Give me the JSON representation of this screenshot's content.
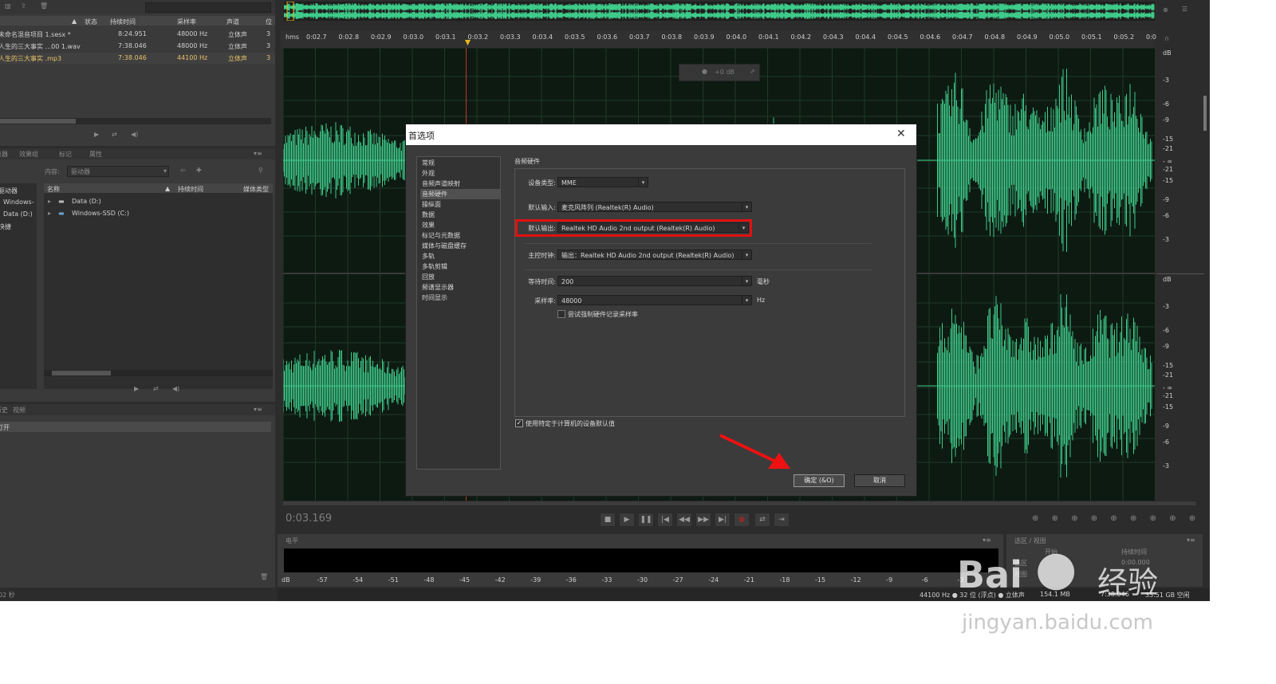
{
  "files_panel": {
    "headers": {
      "status": "状态",
      "duration": "持续时间",
      "sample_rate": "采样率",
      "channels": "声道",
      "extra": "位"
    },
    "rows": [
      {
        "name": "未命名混音项目 1.sesx *",
        "duration": "8:24.951",
        "sample_rate": "48000 Hz",
        "channels": "立体声",
        "extra": "3"
      },
      {
        "name": "人生的三大事实 ...00 1.wav",
        "duration": "7:38.046",
        "sample_rate": "48000 Hz",
        "channels": "立体声",
        "extra": "3"
      },
      {
        "name": "人生的三大事实 .mp3",
        "duration": "7:38.046",
        "sample_rate": "44100 Hz",
        "channels": "立体声",
        "extra": "3"
      }
    ]
  },
  "media_browser": {
    "tabs": [
      "媒体浏览器",
      "效果组",
      "标记",
      "属性"
    ],
    "content_label": "内容:",
    "content_value": "驱动器",
    "left_items": [
      "驱动器",
      "Windows-",
      "Data (D:)",
      "快捷"
    ],
    "headers": {
      "name": "名称",
      "duration": "持续时间",
      "media_type": "媒体类型"
    },
    "items": [
      "Data (D:)",
      "Windows-SSD (C:)"
    ]
  },
  "history_panel": {
    "tab": "历史",
    "tab2": "视频",
    "item": "打开"
  },
  "status_left": "02 秒",
  "ruler": {
    "unit": "hms",
    "ticks": [
      "0:02.7",
      "0:02.8",
      "0:02.9",
      "0:03.0",
      "0:03.1",
      "0:03.2",
      "0:03.3",
      "0:03.4",
      "0:03.5",
      "0:03.6",
      "0:03.7",
      "0:03.8",
      "0:03.9",
      "0:04.0",
      "0:04.1",
      "0:04.2",
      "0:04.3",
      "0:04.4",
      "0:04.5",
      "0:04.6",
      "0:04.7",
      "0:04.8",
      "0:04.9",
      "0:05.0",
      "0:05.1",
      "0:05.2",
      "0:0"
    ]
  },
  "db_scale": {
    "top": [
      "dB",
      "-3",
      "-6",
      "-9",
      "-15",
      "-21",
      "- ∞",
      "-21",
      "-15",
      "-9",
      "-6",
      "-3"
    ],
    "bottom": [
      "dB",
      "-3",
      "-6",
      "-9",
      "-15",
      "-21",
      "- ∞",
      "-21",
      "-15",
      "-9",
      "-6",
      "-3"
    ]
  },
  "hud": {
    "gain": "+0 dB"
  },
  "time_display": "0:03.169",
  "level_meter": {
    "tab": "电平",
    "ticks": [
      "dB",
      "-57",
      "-54",
      "-51",
      "-48",
      "-45",
      "-42",
      "-39",
      "-36",
      "-33",
      "-30",
      "-27",
      "-24",
      "-21",
      "-18",
      "-15",
      "-12",
      "-9",
      "-6",
      "-3"
    ]
  },
  "selection_panel": {
    "tab": "选区 / 视图",
    "start": "开始",
    "duration_label": "持续时间",
    "selection": "选区",
    "view": "视图",
    "value": "0:00.000"
  },
  "status_bar": {
    "text": "44100 Hz ● 32 位 (浮点) ● 立体声",
    "size": "154.1 MB",
    "time": "7:38.046",
    "free": "35.51 GB 空闲"
  },
  "watermark": {
    "brand": "Bai",
    "brand2": "经验",
    "url": "jingyan.baidu.com"
  },
  "dialog": {
    "title": "首选项",
    "close": "✕",
    "categories": [
      "常规",
      "外观",
      "音频声道映射",
      "音频硬件",
      "操纵面",
      "数据",
      "效果",
      "标记与元数据",
      "媒体与磁盘缓存",
      "多轨",
      "多轨剪辑",
      "回放",
      "频谱显示器",
      "时间显示"
    ],
    "active_category": "音频硬件",
    "section_title": "音频硬件",
    "device_type_label": "设备类型:",
    "device_type": "MME",
    "default_input_label": "默认输入:",
    "default_input": "麦克风阵列 (Realtek(R) Audio)",
    "default_output_label": "默认输出:",
    "default_output": "Realtek HD Audio 2nd output (Realtek(R) Audio)",
    "master_clock_label": "主控时钟:",
    "master_clock": "输出：Realtek HD Audio 2nd output (Realtek(R) Audio)",
    "latency_label": "等待时间:",
    "latency": "200",
    "latency_unit": "毫秒",
    "sample_rate_label": "采样率:",
    "sample_rate": "48000",
    "sample_rate_unit": "Hz",
    "force_label": "尝试强制硬件记录采样率",
    "use_default_label": "使用特定于计算机的设备默认值",
    "ok": "确定 (&O)",
    "cancel": "取消"
  },
  "colors": {
    "waveform": "#3ecb8a",
    "highlight": "#e01010",
    "arrow": "#ee1111",
    "playhead": "#e8b91c"
  }
}
